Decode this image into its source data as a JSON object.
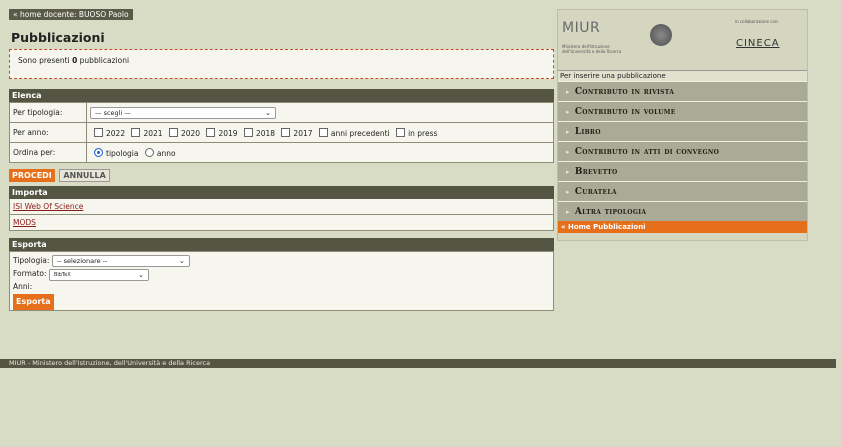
{
  "breadcrumb": "« home docente: BUOSO Paolo",
  "page_title": "Pubblicazioni",
  "notice": {
    "prefix": "Sono presenti ",
    "count": "0",
    "suffix": " pubblicazioni"
  },
  "elenca": {
    "header": "Elenca",
    "tipologia_label": "Per tipologia:",
    "tipologia_value": "— scegli —",
    "anno_label": "Per anno:",
    "anni": [
      "2022",
      "2021",
      "2020",
      "2019",
      "2018",
      "2017",
      "anni precedenti",
      "in press"
    ],
    "ordina_label": "Ordina per:",
    "ordina_options": [
      "tipologia",
      "anno"
    ],
    "ordina_selected": "tipologia"
  },
  "buttons": {
    "procedi": "PROCEDI",
    "annulla": "ANNULLA"
  },
  "importa": {
    "header": "Importa",
    "links": [
      "ISI Web Of Science",
      "MODS"
    ]
  },
  "esporta": {
    "header": "Esporta",
    "tipologia_label": "Tipologia:",
    "tipologia_value": "-- selezionare --",
    "formato_label": "Formato:",
    "formato_value": "BibTeX",
    "anni_label": "Anni:",
    "button": "Esporta"
  },
  "footer": "MIUR - Ministero dell'Istruzione, dell'Università e della Ricerca",
  "sidebar": {
    "miur": "MIUR",
    "miur_subtitle": "Ministero dell'Istruzione dell'Università e della Ricerca",
    "collab": "in collaborazione con:",
    "cineca": "CINECA",
    "instruction": "Per inserire una pubblicazione",
    "items": [
      "Contributo in rivista",
      "Contributo in volume",
      "Libro",
      "Contributo in atti di convegno",
      "Brevetto",
      "Curatela",
      "Altra tipologia"
    ],
    "home": "« Home Pubblicazioni"
  },
  "colors": {
    "accent": "#e56f1a",
    "header_bg": "#555544",
    "page_bg": "#d9dcc5"
  }
}
